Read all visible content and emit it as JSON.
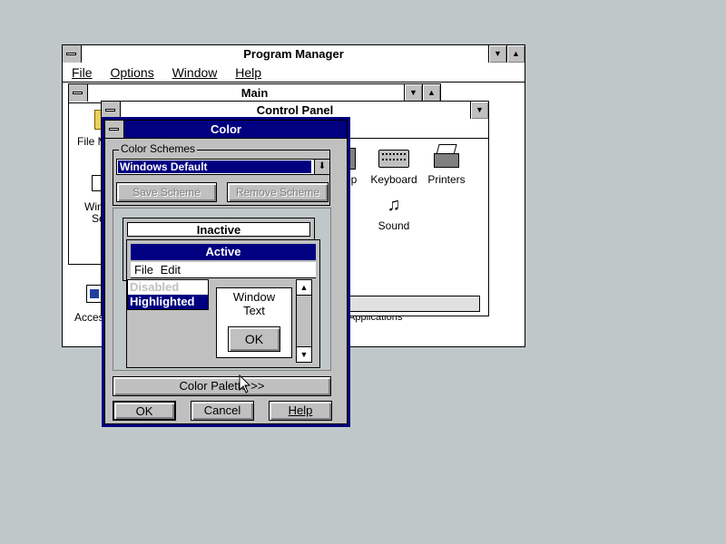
{
  "program_manager": {
    "title": "Program Manager",
    "menu": [
      "File",
      "Options",
      "Window",
      "Help"
    ]
  },
  "main_group": {
    "title": "Main",
    "partial_labels": {
      "file_manager": "File M",
      "windows_setup_1": "Win",
      "windows_setup_2": "Se"
    },
    "bottom_partial_labels": {
      "accessories": "Acces",
      "applications": "Applications"
    }
  },
  "control_panel": {
    "title": "Control Panel",
    "icons": [
      {
        "label": "op",
        "icon": "desktop-icon"
      },
      {
        "label": "Keyboard",
        "icon": "keyboard-icon"
      },
      {
        "label": "Printers",
        "icon": "printer-icon"
      },
      {
        "label": "Sound",
        "icon": "sound-icon"
      }
    ]
  },
  "color_dialog": {
    "title": "Color",
    "schemes_group_label": "Color Schemes",
    "selected_scheme": "Windows Default",
    "save_scheme": "Save Scheme",
    "remove_scheme": "Remove Scheme",
    "preview": {
      "inactive_title": "Inactive",
      "active_title": "Active",
      "menu": [
        "File",
        "Edit"
      ],
      "disabled_item": "Disabled",
      "highlighted_item": "Highlighted",
      "window_text_line1": "Window",
      "window_text_line2": "Text",
      "ok_label": "OK"
    },
    "color_palette_button": "Color Palette >>",
    "ok_button": "OK",
    "cancel_button": "Cancel",
    "help_button": "Help"
  },
  "colors": {
    "desktop": "#c0c7c8",
    "active_title": "#000080",
    "button_face": "#c0c0c0",
    "highlight": "#000080"
  }
}
